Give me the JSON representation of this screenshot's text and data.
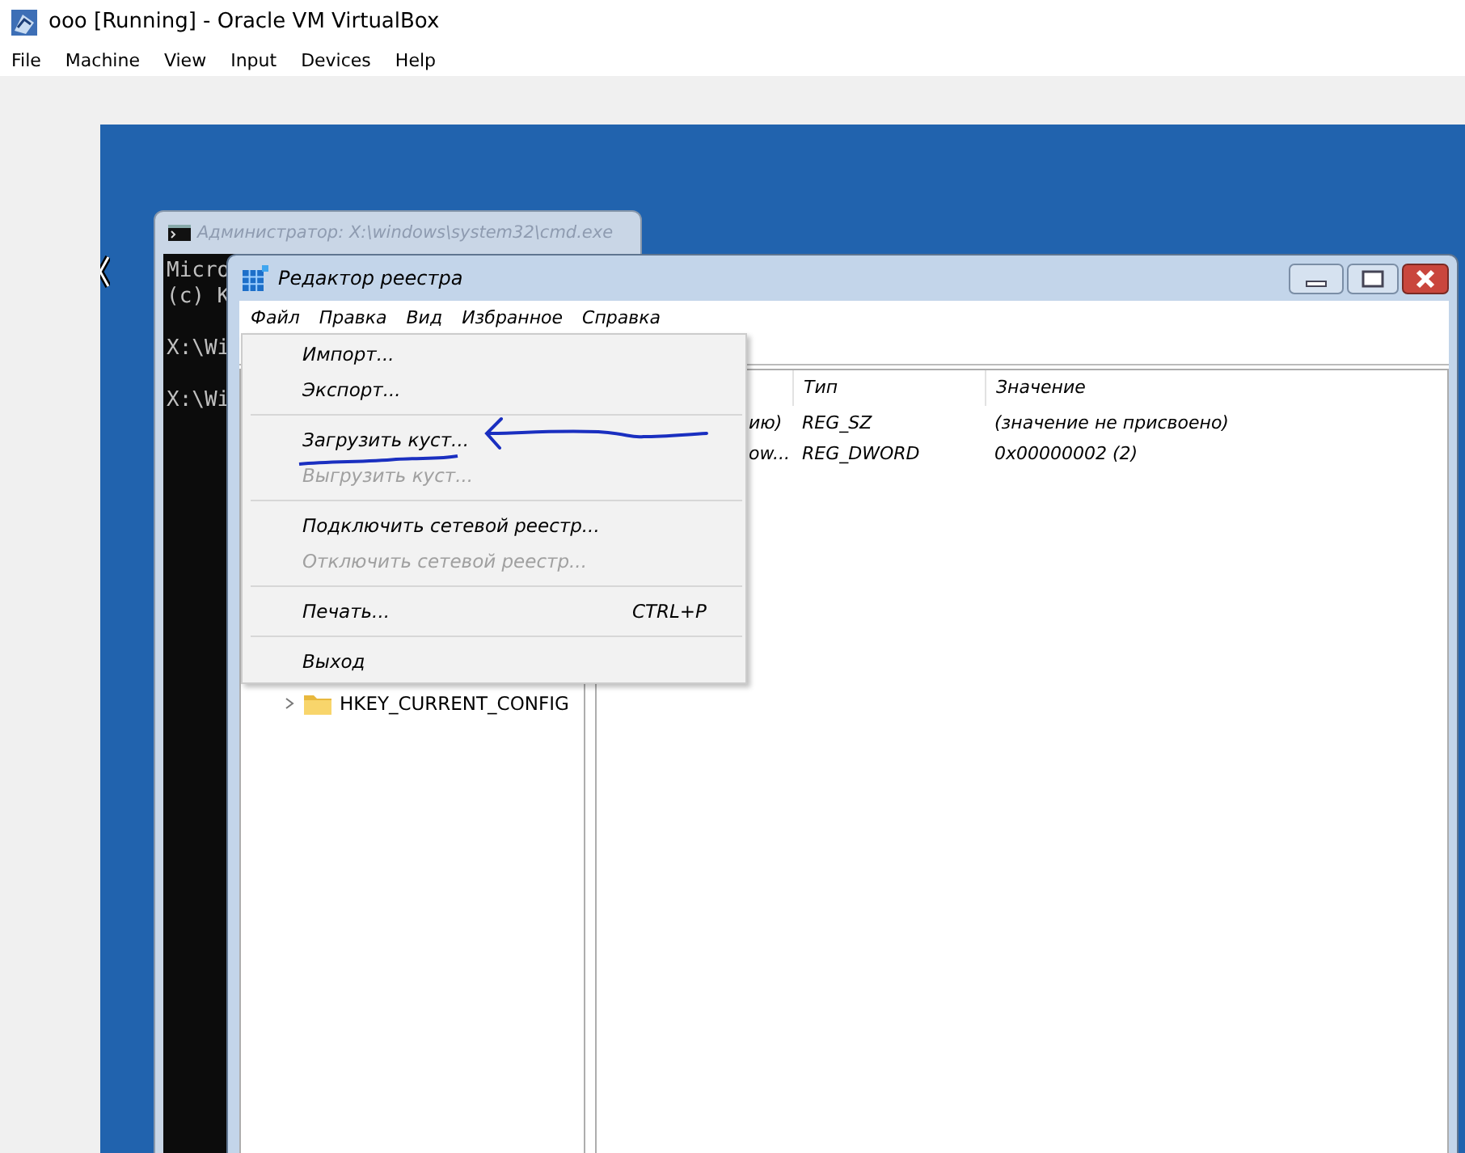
{
  "window": {
    "title": "ooo [Running] - Oracle VM VirtualBox"
  },
  "menu_bar": [
    "File",
    "Machine",
    "View",
    "Input",
    "Devices",
    "Help"
  ],
  "console_window": {
    "title": "Администратор: X:\\windows\\system32\\cmd.exe",
    "active": false,
    "blocks": [
      [
        "Micro",
        "(c) K"
      ],
      [
        "X:\\Wi"
      ],
      [
        "X:\\Wi"
      ]
    ]
  },
  "registry_editor": {
    "title": "Редактор реестра",
    "active": true,
    "menu": [
      "Файл",
      "Правка",
      "Вид",
      "Избранное",
      "Справка"
    ],
    "file_menu": [
      {
        "kind": "item",
        "label": "Импорт...",
        "disabled": false
      },
      {
        "kind": "item",
        "label": "Экспорт...",
        "disabled": false
      },
      {
        "kind": "separator"
      },
      {
        "kind": "item",
        "label": "Загрузить куст...",
        "disabled": false
      },
      {
        "kind": "item",
        "label": "Выгрузить куст...",
        "disabled": true
      },
      {
        "kind": "separator"
      },
      {
        "kind": "item",
        "label": "Подключить сетевой реестр...",
        "disabled": false
      },
      {
        "kind": "item",
        "label": "Отключить сетевой реестр...",
        "disabled": true
      },
      {
        "kind": "separator"
      },
      {
        "kind": "item",
        "label": "Печать...",
        "disabled": false,
        "shortcut": "CTRL+P"
      },
      {
        "kind": "separator"
      },
      {
        "kind": "item",
        "label": "Выход",
        "disabled": false
      }
    ],
    "tree": [
      {
        "label": "HKEY_CURRENT_CONFIG",
        "expanded": false
      }
    ],
    "list": {
      "columns": [
        "Тип",
        "Значение"
      ],
      "rows": [
        {
          "name": "ию)",
          "type": "REG_SZ",
          "value": "(значение не присвоено)"
        },
        {
          "name": "ow...",
          "type": "REG_DWORD",
          "value": "0x00000002 (2)"
        }
      ]
    }
  }
}
